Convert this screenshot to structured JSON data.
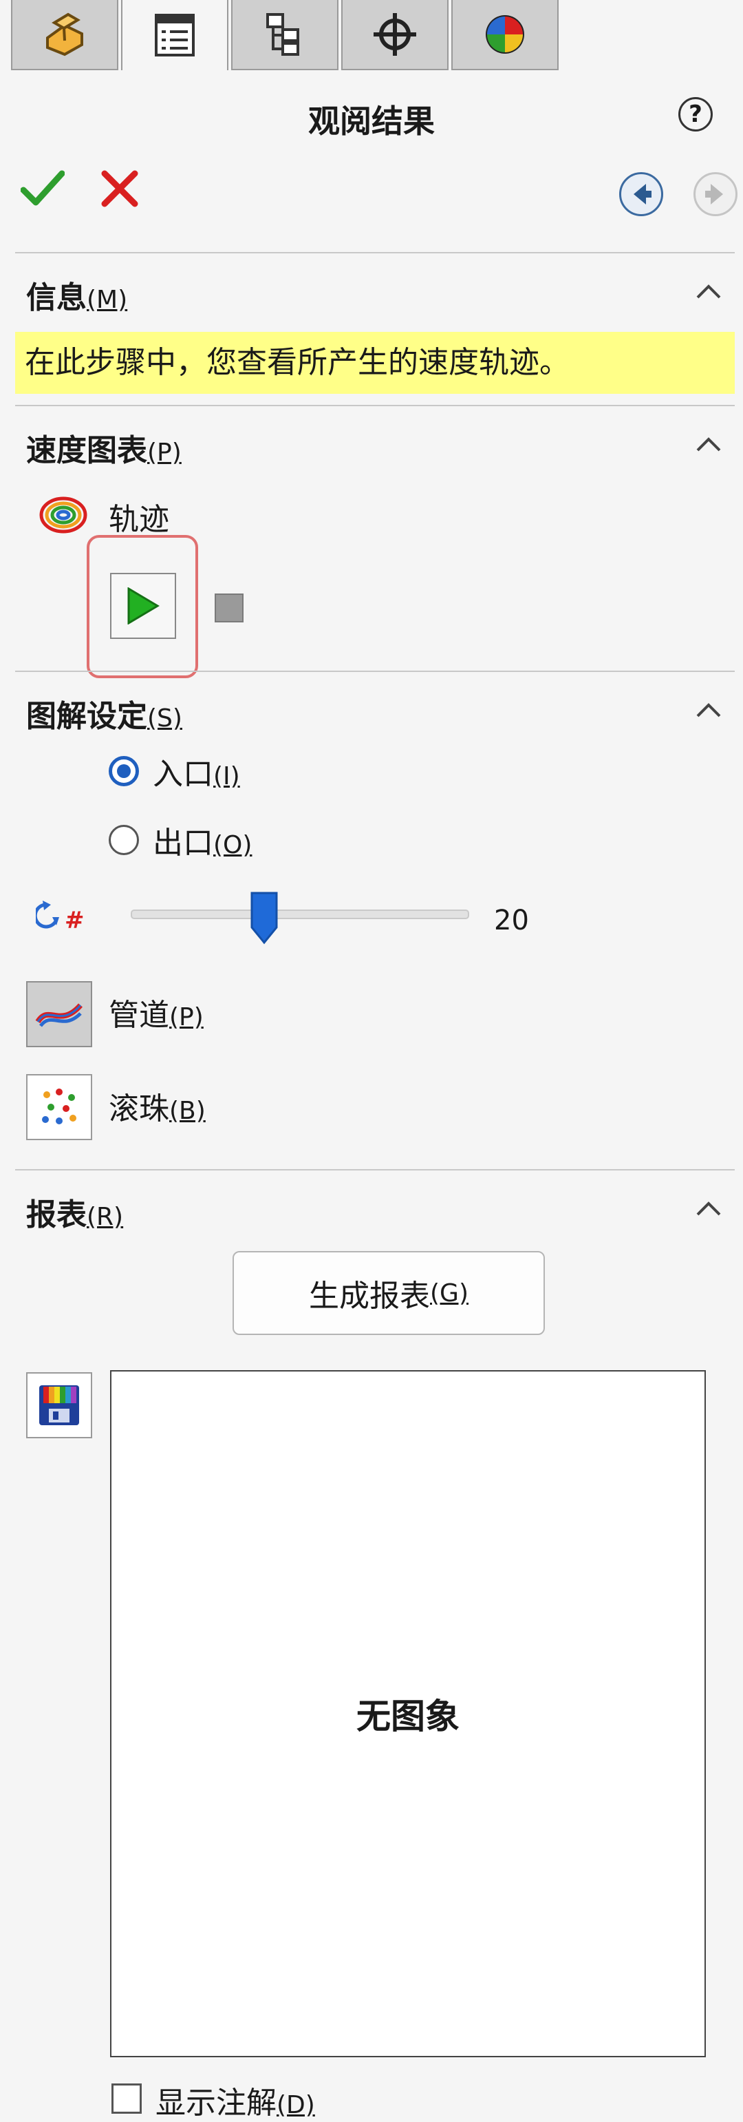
{
  "tabs": [
    {
      "icon": "part-feature-icon"
    },
    {
      "icon": "property-manager-icon"
    },
    {
      "icon": "configuration-manager-icon"
    },
    {
      "icon": "dimxpert-icon"
    },
    {
      "icon": "display-manager-icon"
    }
  ],
  "header": {
    "title": "观阅结果",
    "help_symbol": "?"
  },
  "sections": {
    "info": {
      "title": "信息",
      "accel": "(M)",
      "message": "在此步骤中，您查看所产生的速度轨迹。"
    },
    "velocity": {
      "title": "速度图表",
      "accel": "(P)",
      "trajectory_label": "轨迹"
    },
    "plot": {
      "title": "图解设定",
      "accel": "(S)",
      "inlet_label": "入口",
      "inlet_accel": "(I)",
      "outlet_label": "出口",
      "outlet_accel": "(O)",
      "selected": "inlet",
      "slider_value": "20",
      "slider_fraction": 0.35,
      "pipes_label": "管道",
      "pipes_accel": "(P)",
      "balls_label": "滚珠",
      "balls_accel": "(B)"
    },
    "report": {
      "title": "报表",
      "accel": "(R)",
      "generate_label": "生成报表",
      "generate_accel": "(G)",
      "no_image_text": "无图象",
      "annotation_label": "显示注解",
      "annotation_accel": "(D)"
    }
  },
  "colors": {
    "accept": "#2e9e2e",
    "cancel": "#d92020",
    "highlight": "#ffff88",
    "accent": "#1f5fbf",
    "play": "#22b022"
  }
}
